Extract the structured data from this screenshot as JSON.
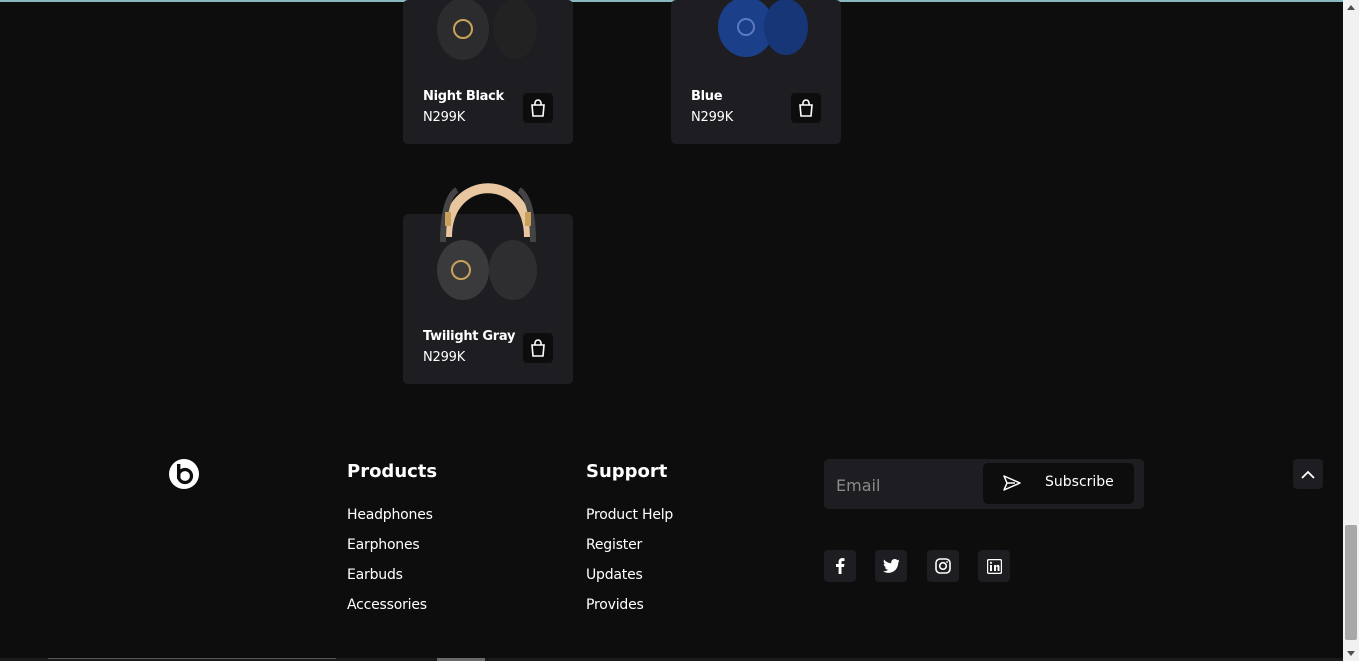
{
  "products": [
    {
      "name": "Night Black",
      "price": "N299K",
      "color": "#2b2a2e"
    },
    {
      "name": "Blue",
      "price": "N299K",
      "color": "#1c3f8a"
    },
    {
      "name": "Twilight Gray",
      "price": "N299K",
      "color": "#3a3a3c"
    }
  ],
  "footer": {
    "products": {
      "title": "Products",
      "links": [
        "Headphones",
        "Earphones",
        "Earbuds",
        "Accessories"
      ]
    },
    "support": {
      "title": "Support",
      "links": [
        "Product Help",
        "Register",
        "Updates",
        "Provides"
      ]
    },
    "newsletter": {
      "email_placeholder": "Email",
      "subscribe_label": "Subscribe"
    },
    "social": [
      "facebook-icon",
      "twitter-icon",
      "instagram-icon",
      "linkedin-icon"
    ]
  },
  "colors": {
    "background": "#0e0d0e",
    "card": "#1e1d21",
    "accent_gold": "#c8a25a",
    "accent_blue": "#1c3f8a"
  }
}
